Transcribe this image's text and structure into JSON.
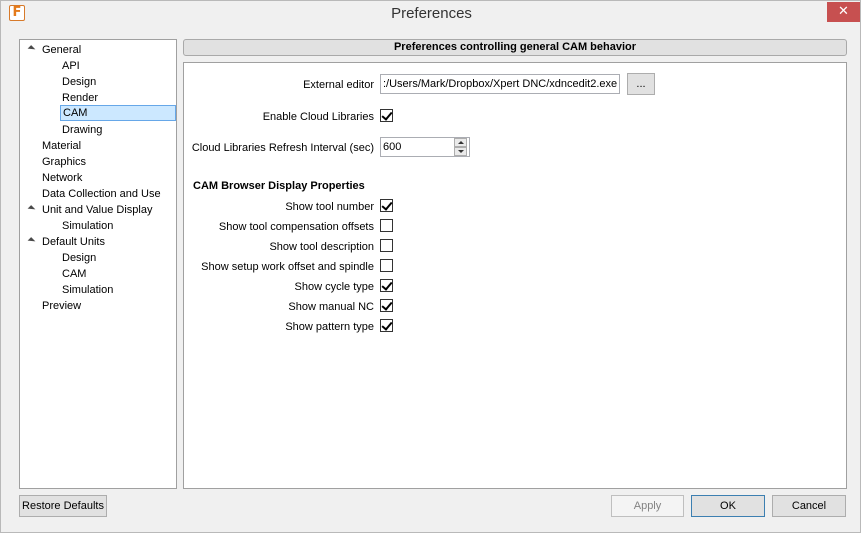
{
  "window": {
    "title": "Preferences",
    "app_icon": "F",
    "close_glyph": "✕"
  },
  "tree": {
    "items": [
      {
        "label": "General",
        "level": 0,
        "expanded": true
      },
      {
        "label": "API",
        "level": 1
      },
      {
        "label": "Design",
        "level": 1
      },
      {
        "label": "Render",
        "level": 1
      },
      {
        "label": "CAM",
        "level": 1,
        "selected": true
      },
      {
        "label": "Drawing",
        "level": 1
      },
      {
        "label": "Material",
        "level": 0
      },
      {
        "label": "Graphics",
        "level": 0
      },
      {
        "label": "Network",
        "level": 0
      },
      {
        "label": "Data Collection and Use",
        "level": 0
      },
      {
        "label": "Unit and Value Display",
        "level": 0,
        "expanded": true
      },
      {
        "label": "Simulation",
        "level": 1
      },
      {
        "label": "Default Units",
        "level": 0,
        "expanded": true
      },
      {
        "label": "Design",
        "level": 1
      },
      {
        "label": "CAM",
        "level": 1
      },
      {
        "label": "Simulation",
        "level": 1
      },
      {
        "label": "Preview",
        "level": 0
      }
    ]
  },
  "panel": {
    "header": "Preferences controlling general CAM behavior",
    "external_editor": {
      "label": "External editor",
      "value": ":/Users/Mark/Dropbox/Xpert DNC/xdncedit2.exe",
      "browse_label": "..."
    },
    "enable_cloud_libraries": {
      "label": "Enable Cloud Libraries",
      "checked": true
    },
    "refresh_interval": {
      "label": "Cloud Libraries Refresh Interval (sec)",
      "value": "600"
    },
    "browser_section": {
      "title": "CAM Browser Display Properties",
      "options": [
        {
          "label": "Show tool number",
          "checked": true
        },
        {
          "label": "Show tool compensation offsets",
          "checked": false
        },
        {
          "label": "Show tool description",
          "checked": false
        },
        {
          "label": "Show setup work offset and spindle",
          "checked": false
        },
        {
          "label": "Show cycle type",
          "checked": true
        },
        {
          "label": "Show manual NC",
          "checked": true
        },
        {
          "label": "Show pattern type",
          "checked": true
        }
      ]
    }
  },
  "footer": {
    "restore_label": "Restore Defaults",
    "apply_label": "Apply",
    "ok_label": "OK",
    "cancel_label": "Cancel"
  }
}
